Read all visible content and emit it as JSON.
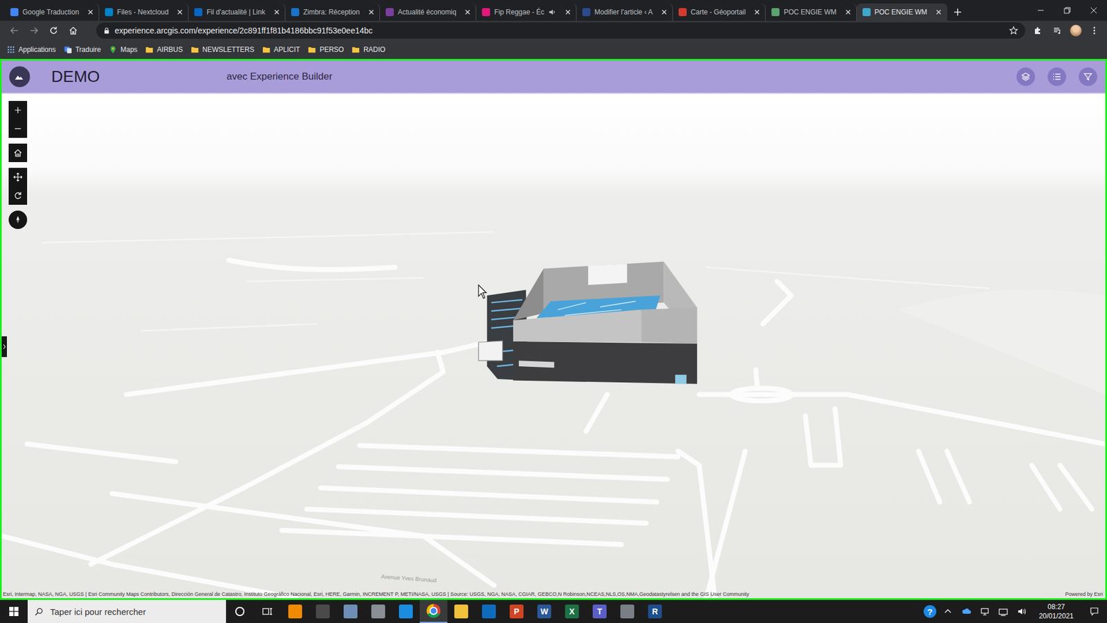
{
  "browser": {
    "tabs": [
      {
        "label": "Google Traduction",
        "selected": false,
        "audio": false,
        "color": "#4285f4"
      },
      {
        "label": "Files - Nextcloud",
        "selected": false,
        "audio": false,
        "color": "#0082c9"
      },
      {
        "label": "Fil d'actualité | Link",
        "selected": false,
        "audio": false,
        "color": "#0a66c2"
      },
      {
        "label": "Zimbra: Réception",
        "selected": false,
        "audio": false,
        "color": "#1a73c8"
      },
      {
        "label": "Actualité économiq",
        "selected": false,
        "audio": false,
        "color": "#7b3fa0"
      },
      {
        "label": "Fip Reggae - Éc",
        "selected": false,
        "audio": true,
        "color": "#e2197a"
      },
      {
        "label": "Modifier l'article ‹ A",
        "selected": false,
        "audio": false,
        "color": "#2a4b8d"
      },
      {
        "label": "Carte - Géoportail",
        "selected": false,
        "audio": false,
        "color": "#d23b2e"
      },
      {
        "label": "POC ENGIE WM",
        "selected": false,
        "audio": false,
        "color": "#5aa36f"
      },
      {
        "label": "POC ENGIE WM",
        "selected": true,
        "audio": false,
        "color": "#3fa7c9"
      }
    ],
    "url": "experience.arcgis.com/experience/2c891ff1f81b4186bbc91f53e0ee14bc",
    "bookmarks": [
      {
        "label": "Applications",
        "kind": "apps"
      },
      {
        "label": "Traduire",
        "kind": "translate"
      },
      {
        "label": "Maps",
        "kind": "maps"
      },
      {
        "label": "AIRBUS",
        "kind": "folder"
      },
      {
        "label": "NEWSLETTERS",
        "kind": "folder"
      },
      {
        "label": "APLICIT",
        "kind": "folder"
      },
      {
        "label": "PERSO",
        "kind": "folder"
      },
      {
        "label": "RADIO",
        "kind": "folder"
      }
    ]
  },
  "app": {
    "title": "DEMO",
    "subtitle": "avec Experience Builder"
  },
  "map": {
    "labels": [
      "Avenue Yves Brunaud"
    ],
    "attribution": "Esri, Intermap, NASA, NGA, USGS | Esri Community Maps Contributors, Dirección General de Catastro, Instituto Geográfico Nacional, Esri, HERE, Garmin, INCREMENT P, METI/NASA, USGS | Source: USGS, NGA, NASA, CGIAR, GEBCO,N Robinson,NCEAS,NLS,OS,NMA,Geodatastyrelsen and the GIS User Community",
    "powered_by": "Powered by Esri"
  },
  "taskbar": {
    "search_placeholder": "Taper ici pour rechercher",
    "apps": [
      {
        "kind": "cortana",
        "glyph": "",
        "color": "#ffffff",
        "selected": false
      },
      {
        "kind": "taskview",
        "glyph": "",
        "color": "#ffffff",
        "selected": false
      },
      {
        "kind": "tile",
        "glyph": "",
        "color": "#f08a00",
        "selected": false
      },
      {
        "kind": "tile",
        "glyph": "",
        "color": "#4a4a4a",
        "selected": false
      },
      {
        "kind": "tile",
        "glyph": "",
        "color": "#6d8fb5",
        "selected": false
      },
      {
        "kind": "tile",
        "glyph": "",
        "color": "#8a8f96",
        "selected": false
      },
      {
        "kind": "tile",
        "glyph": "",
        "color": "#1a8de0",
        "selected": false
      },
      {
        "kind": "chrome",
        "glyph": "",
        "color": "#4285f4",
        "selected": true
      },
      {
        "kind": "tile",
        "glyph": "",
        "color": "#f2c23a",
        "selected": false
      },
      {
        "kind": "tile",
        "glyph": "",
        "color": "#0f6cbd",
        "selected": false
      },
      {
        "kind": "tile",
        "glyph": "P",
        "color": "#d04423",
        "selected": false
      },
      {
        "kind": "tile",
        "glyph": "W",
        "color": "#2b5797",
        "selected": false
      },
      {
        "kind": "tile",
        "glyph": "X",
        "color": "#1e7145",
        "selected": false
      },
      {
        "kind": "tile",
        "glyph": "T",
        "color": "#5b5fc7",
        "selected": false
      },
      {
        "kind": "tile",
        "glyph": "",
        "color": "#7a7f87",
        "selected": false
      },
      {
        "kind": "tile",
        "glyph": "R",
        "color": "#1f4e8c",
        "selected": false
      }
    ],
    "help": "?",
    "time": "08:27",
    "date": "20/01/2021"
  }
}
